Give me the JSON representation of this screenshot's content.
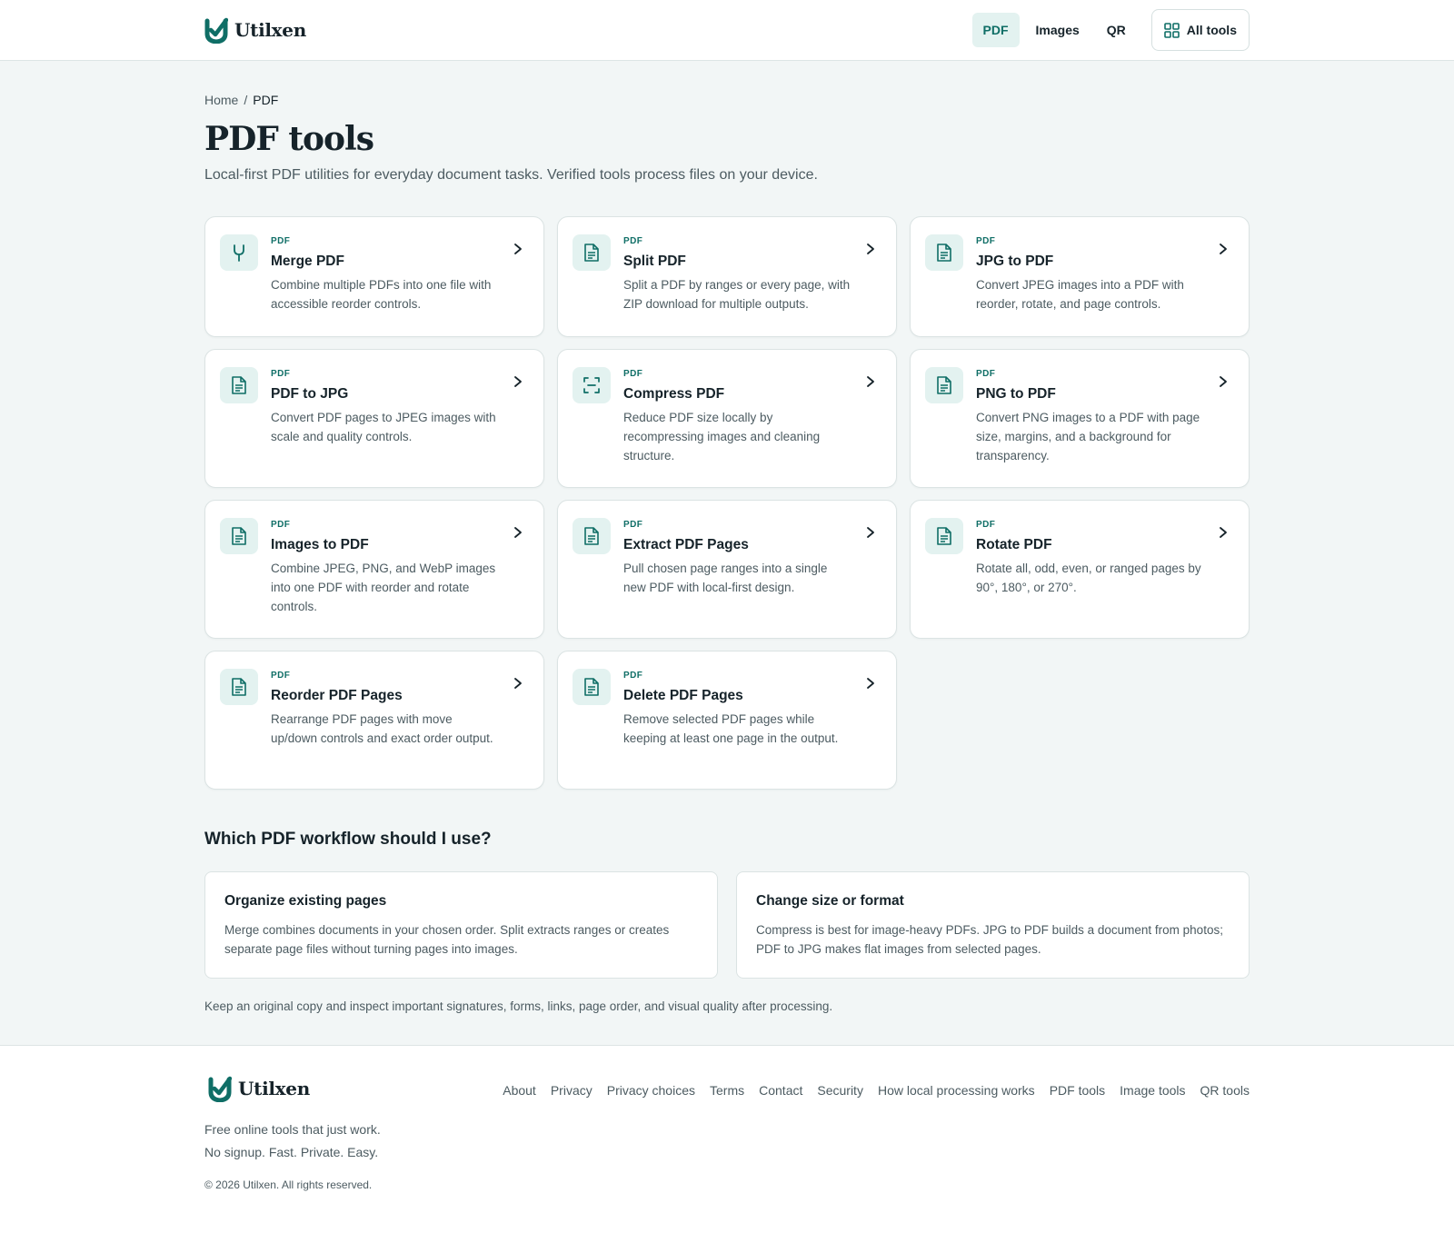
{
  "brand": {
    "name": "Utilxen",
    "accent": "#0f6e66",
    "accent_bg": "#e3f2f0"
  },
  "nav": {
    "items": [
      {
        "label": "PDF",
        "active": true
      },
      {
        "label": "Images",
        "active": false
      },
      {
        "label": "QR",
        "active": false
      }
    ],
    "all_tools": {
      "label": "All tools",
      "icon": "grid-icon"
    }
  },
  "breadcrumb": {
    "home": "Home",
    "separator": "/",
    "current": "PDF"
  },
  "page": {
    "title": "PDF tools",
    "subtitle": "Local-first PDF utilities for everyday document tasks. Verified tools process files on your device."
  },
  "tools": [
    {
      "tag": "PDF",
      "title": "Merge PDF",
      "desc": "Combine multiple PDFs into one file with accessible reorder controls.",
      "icon": "merge-icon"
    },
    {
      "tag": "PDF",
      "title": "Split PDF",
      "desc": "Split a PDF by ranges or every page, with ZIP download for multiple outputs.",
      "icon": "file-icon"
    },
    {
      "tag": "PDF",
      "title": "JPG to PDF",
      "desc": "Convert JPEG images into a PDF with reorder, rotate, and page controls.",
      "icon": "file-icon"
    },
    {
      "tag": "PDF",
      "title": "PDF to JPG",
      "desc": "Convert PDF pages to JPEG images with scale and quality controls.",
      "icon": "file-icon"
    },
    {
      "tag": "PDF",
      "title": "Compress PDF",
      "desc": "Reduce PDF size locally by recompressing images and cleaning structure.",
      "icon": "compress-icon"
    },
    {
      "tag": "PDF",
      "title": "PNG to PDF",
      "desc": "Convert PNG images to a PDF with page size, margins, and a background for transparency.",
      "icon": "file-icon"
    },
    {
      "tag": "PDF",
      "title": "Images to PDF",
      "desc": "Combine JPEG, PNG, and WebP images into one PDF with reorder and rotate controls.",
      "icon": "file-icon"
    },
    {
      "tag": "PDF",
      "title": "Extract PDF Pages",
      "desc": "Pull chosen page ranges into a single new PDF with local-first design.",
      "icon": "file-icon"
    },
    {
      "tag": "PDF",
      "title": "Rotate PDF",
      "desc": "Rotate all, odd, even, or ranged pages by 90°, 180°, or 270°.",
      "icon": "file-icon"
    },
    {
      "tag": "PDF",
      "title": "Reorder PDF Pages",
      "desc": "Rearrange PDF pages with move up/down controls and exact order output.",
      "icon": "file-icon"
    },
    {
      "tag": "PDF",
      "title": "Delete PDF Pages",
      "desc": "Remove selected PDF pages while keeping at least one page in the output.",
      "icon": "file-icon"
    }
  ],
  "workflow": {
    "title": "Which PDF workflow should I use?",
    "cards": [
      {
        "title": "Organize existing pages",
        "desc": "Merge combines documents in your chosen order. Split extracts ranges or creates separate page files without turning pages into images."
      },
      {
        "title": "Change size or format",
        "desc": "Compress is best for image-heavy PDFs. JPG to PDF builds a document from photos; PDF to JPG makes flat images from selected pages."
      }
    ],
    "note": "Keep an original copy and inspect important signatures, forms, links, page order, and visual quality after processing."
  },
  "footer": {
    "tagline1": "Free online tools that just work.",
    "tagline2": "No signup. Fast. Private. Easy.",
    "copyright": "© 2026 Utilxen. All rights reserved.",
    "links": [
      "About",
      "Privacy",
      "Privacy choices",
      "Terms",
      "Contact",
      "Security",
      "How local processing works",
      "PDF tools",
      "Image tools",
      "QR tools"
    ]
  }
}
